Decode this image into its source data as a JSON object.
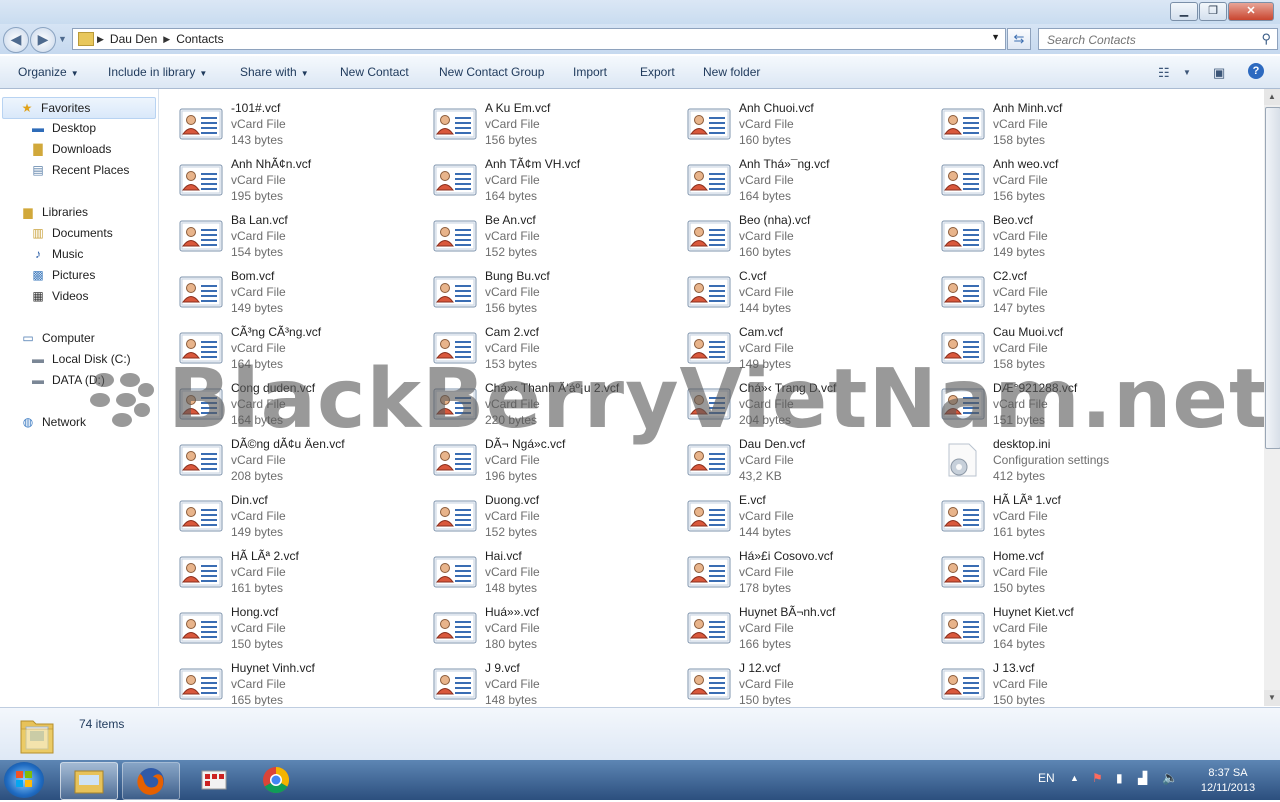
{
  "window": {
    "buttons": [
      "minimize",
      "maximize",
      "close"
    ]
  },
  "address": {
    "breadcrumbs": [
      "Dau Den",
      "Contacts"
    ],
    "search_placeholder": "Search Contacts"
  },
  "toolbar": {
    "organize": "Organize",
    "include_in_library": "Include in library",
    "share_with": "Share with",
    "new_contact": "New Contact",
    "new_contact_group": "New Contact Group",
    "import": "Import",
    "export": "Export",
    "new_folder": "New folder"
  },
  "nav": {
    "favorites": "Favorites",
    "desktop": "Desktop",
    "downloads": "Downloads",
    "recent_places": "Recent Places",
    "libraries": "Libraries",
    "documents": "Documents",
    "music": "Music",
    "pictures": "Pictures",
    "videos": "Videos",
    "computer": "Computer",
    "local_disk": "Local Disk (C:)",
    "data_drive": "DATA (D:)",
    "network": "Network"
  },
  "files": [
    {
      "name": "-101#.vcf",
      "type": "vCard File",
      "size": "143 bytes"
    },
    {
      "name": "A Ku Em.vcf",
      "type": "vCard File",
      "size": "156 bytes"
    },
    {
      "name": "Anh Chuoi.vcf",
      "type": "vCard File",
      "size": "160 bytes"
    },
    {
      "name": "Anh Minh.vcf",
      "type": "vCard File",
      "size": "158 bytes"
    },
    {
      "name": "Anh NhÃ¢n.vcf",
      "type": "vCard File",
      "size": "195 bytes"
    },
    {
      "name": "Anh TÃ¢m VH.vcf",
      "type": "vCard File",
      "size": "164 bytes"
    },
    {
      "name": "Anh Thá»¯ng.vcf",
      "type": "vCard File",
      "size": "164 bytes"
    },
    {
      "name": "Anh weo.vcf",
      "type": "vCard File",
      "size": "156 bytes"
    },
    {
      "name": "Ba Lan.vcf",
      "type": "vCard File",
      "size": "154 bytes"
    },
    {
      "name": "Be An.vcf",
      "type": "vCard File",
      "size": "152 bytes"
    },
    {
      "name": "Beo (nha).vcf",
      "type": "vCard File",
      "size": "160 bytes"
    },
    {
      "name": "Beo.vcf",
      "type": "vCard File",
      "size": "149 bytes"
    },
    {
      "name": "Bom.vcf",
      "type": "vCard File",
      "size": "149 bytes"
    },
    {
      "name": "Bung Bu.vcf",
      "type": "vCard File",
      "size": "156 bytes"
    },
    {
      "name": "C.vcf",
      "type": "vCard File",
      "size": "144 bytes"
    },
    {
      "name": "C2.vcf",
      "type": "vCard File",
      "size": "147 bytes"
    },
    {
      "name": "CÃ³ng CÃ³ng.vcf",
      "type": "vCard File",
      "size": "164 bytes"
    },
    {
      "name": "Cam 2.vcf",
      "type": "vCard File",
      "size": "153 bytes"
    },
    {
      "name": "Cam.vcf",
      "type": "vCard File",
      "size": "149 bytes"
    },
    {
      "name": "Cau Muoi.vcf",
      "type": "vCard File",
      "size": "158 bytes"
    },
    {
      "name": "Cong duden.vcf",
      "type": "vCard File",
      "size": "164 bytes"
    },
    {
      "name": "Chá»‹ Thanh Ä‘áº¡u 2.vcf",
      "type": "vCard File",
      "size": "220 bytes"
    },
    {
      "name": "Chá»‹ Trang D.vcf",
      "type": "vCard File",
      "size": "204 bytes"
    },
    {
      "name": "DÆ°921288.vcf",
      "type": "vCard File",
      "size": "151 bytes"
    },
    {
      "name": "DÃ©ng dÃ¢u Äen.vcf",
      "type": "vCard File",
      "size": "208 bytes"
    },
    {
      "name": "DÃ¬ Ngá»c.vcf",
      "type": "vCard File",
      "size": "196 bytes"
    },
    {
      "name": "Dau Den.vcf",
      "type": "vCard File",
      "size": "43,2 KB"
    },
    {
      "name": "desktop.ini",
      "type": "Configuration settings",
      "size": "412 bytes",
      "kind": "ini"
    },
    {
      "name": "Din.vcf",
      "type": "vCard File",
      "size": "149 bytes"
    },
    {
      "name": "Duong.vcf",
      "type": "vCard File",
      "size": "152 bytes"
    },
    {
      "name": "E.vcf",
      "type": "vCard File",
      "size": "144 bytes"
    },
    {
      "name": "HÃ  LÃª 1.vcf",
      "type": "vCard File",
      "size": "161 bytes"
    },
    {
      "name": "HÃ  LÃª 2.vcf",
      "type": "vCard File",
      "size": "161 bytes"
    },
    {
      "name": "Hai.vcf",
      "type": "vCard File",
      "size": "148 bytes"
    },
    {
      "name": "Há»£i Cosovo.vcf",
      "type": "vCard File",
      "size": "178 bytes"
    },
    {
      "name": "Home.vcf",
      "type": "vCard File",
      "size": "150 bytes"
    },
    {
      "name": "Hong.vcf",
      "type": "vCard File",
      "size": "150 bytes"
    },
    {
      "name": "Huá»».vcf",
      "type": "vCard File",
      "size": "180 bytes"
    },
    {
      "name": "Huynet BÃ¬nh.vcf",
      "type": "vCard File",
      "size": "166 bytes"
    },
    {
      "name": "Huynet Kiet.vcf",
      "type": "vCard File",
      "size": "164 bytes"
    },
    {
      "name": "Huynet Vinh.vcf",
      "type": "vCard File",
      "size": "165 bytes"
    },
    {
      "name": "J 9.vcf",
      "type": "vCard File",
      "size": "148 bytes"
    },
    {
      "name": "J 12.vcf",
      "type": "vCard File",
      "size": "150 bytes"
    },
    {
      "name": "J 13.vcf",
      "type": "vCard File",
      "size": "150 bytes"
    }
  ],
  "watermark": "BlackBerryVietNam.net",
  "status": {
    "item_count": "74 items"
  },
  "taskbar": {
    "language": "EN",
    "time": "8:37 SA",
    "date": "12/11/2013"
  }
}
